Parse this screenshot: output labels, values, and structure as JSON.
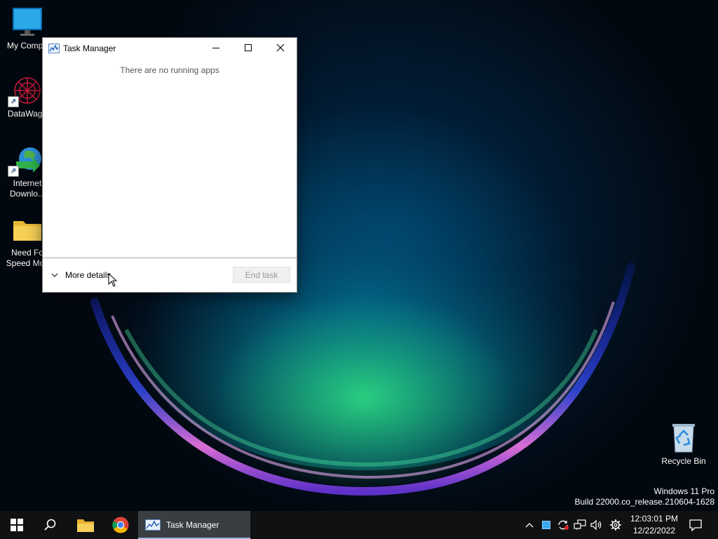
{
  "desktop": {
    "icons": [
      {
        "label_line1": "My Compu",
        "label_line2": "",
        "icon": "monitor-icon"
      },
      {
        "label_line1": "DataWago",
        "label_line2": "",
        "icon": "datawagon-icon"
      },
      {
        "label_line1": "Internet",
        "label_line2": "Downlo...",
        "icon": "internet-download-manager-icon"
      },
      {
        "label_line1": "Need Fo",
        "label_line2": "Speed Mos",
        "icon": "folder-icon"
      }
    ],
    "recycle_bin": {
      "label": "Recycle Bin",
      "icon": "recycle-bin-icon"
    },
    "watermark": {
      "line1": "Windows 11 Pro",
      "line2": "Build 22000.co_release.210604-1628"
    }
  },
  "task_manager": {
    "title": "Task Manager",
    "empty_message": "There are no running apps",
    "more_details": "More details",
    "end_task": "End task"
  },
  "taskbar": {
    "items": [
      "start-icon",
      "search-icon",
      "file-explorer-icon",
      "chrome-icon"
    ],
    "active_app_label": "Task Manager",
    "tray_icons": [
      "chevron-up-icon",
      "blue-square-icon",
      "sync-icon",
      "network-icon",
      "volume-icon",
      "settings-gear-icon"
    ],
    "time": "12:03:01 PM",
    "date": "12/22/2022",
    "notification_icon": "notification-icon"
  },
  "colors": {
    "taskbar": "#101113",
    "active_taskbar_item": "#3a3d42",
    "window_bg": "#ffffff"
  }
}
